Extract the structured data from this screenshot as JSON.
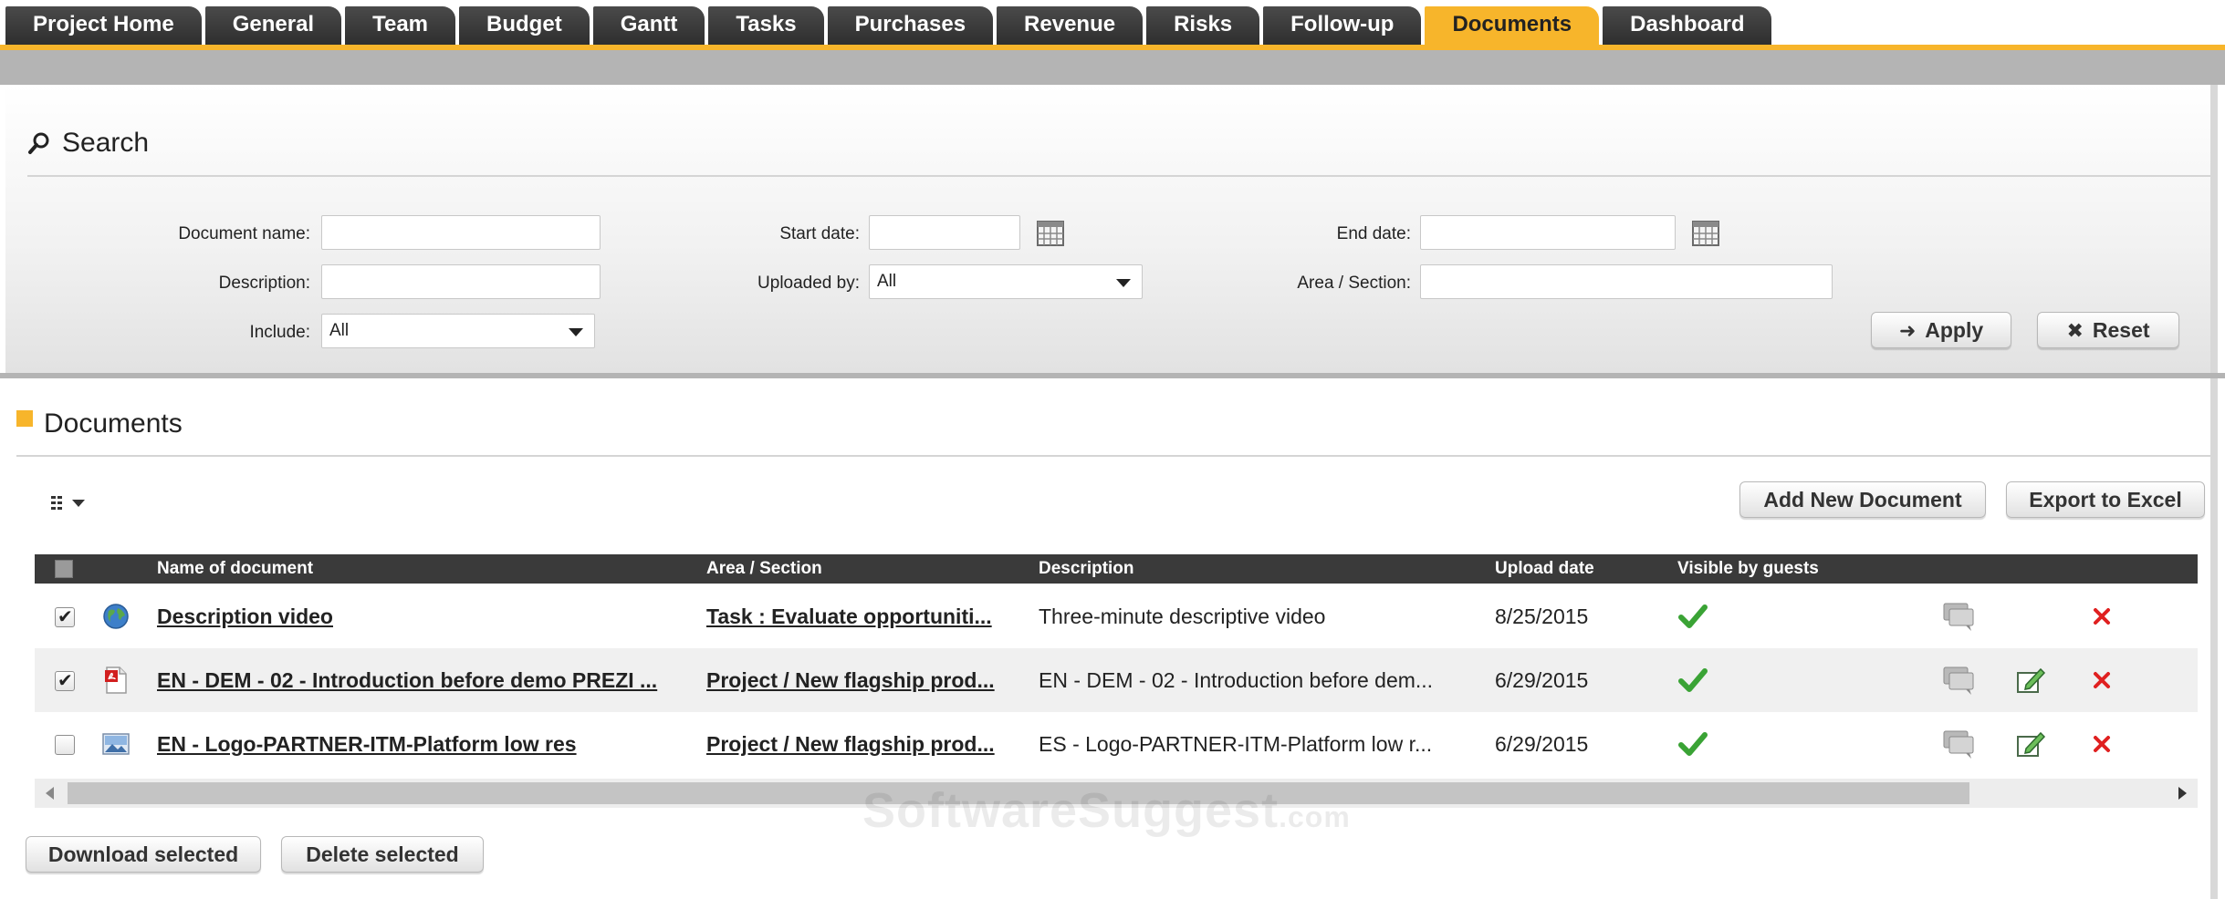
{
  "tabs": [
    {
      "label": "Project Home",
      "active": false
    },
    {
      "label": "General",
      "active": false
    },
    {
      "label": "Team",
      "active": false
    },
    {
      "label": "Budget",
      "active": false
    },
    {
      "label": "Gantt",
      "active": false
    },
    {
      "label": "Tasks",
      "active": false
    },
    {
      "label": "Purchases",
      "active": false
    },
    {
      "label": "Revenue",
      "active": false
    },
    {
      "label": "Risks",
      "active": false
    },
    {
      "label": "Follow-up",
      "active": false
    },
    {
      "label": "Documents",
      "active": true
    },
    {
      "label": "Dashboard",
      "active": false
    }
  ],
  "colors": {
    "accent": "#f7b52b",
    "tab_dark": "#3a3a3a",
    "check_green": "#3aa335",
    "delete_red": "#e02020"
  },
  "search": {
    "title": "Search",
    "icon": "search-icon",
    "fields": {
      "document_name": {
        "label": "Document name:",
        "value": ""
      },
      "description": {
        "label": "Description:",
        "value": ""
      },
      "include": {
        "label": "Include:",
        "value": "All"
      },
      "start_date": {
        "label": "Start date:",
        "value": ""
      },
      "uploaded_by": {
        "label": "Uploaded by:",
        "value": "All"
      },
      "end_date": {
        "label": "End date:",
        "value": ""
      },
      "area_section": {
        "label": "Area / Section:",
        "value": ""
      }
    },
    "apply_label": "Apply",
    "reset_label": "Reset"
  },
  "documents": {
    "title": "Documents",
    "add_button": "Add New Document",
    "export_button": "Export to Excel",
    "columns": {
      "name": "Name of document",
      "area": "Area / Section",
      "description": "Description",
      "upload_date": "Upload date",
      "visible": "Visible by guests"
    },
    "rows": [
      {
        "checked": true,
        "icon": "globe-icon",
        "name": "Description video",
        "area": "Task : Evaluate opportuniti...",
        "description": "Three-minute descriptive video",
        "upload_date": "8/25/2015",
        "visible": true,
        "editable": false
      },
      {
        "checked": true,
        "icon": "pdf-icon",
        "name": "EN - DEM - 02 - Introduction before demo PREZI ...",
        "area": "Project / New flagship prod...",
        "description": "EN - DEM - 02 - Introduction before dem...",
        "upload_date": "6/29/2015",
        "visible": true,
        "editable": true
      },
      {
        "checked": false,
        "icon": "image-icon",
        "name": "EN - Logo-PARTNER-ITM-Platform low res",
        "area": "Project / New flagship prod...",
        "description": "ES - Logo-PARTNER-ITM-Platform low r...",
        "upload_date": "6/29/2015",
        "visible": true,
        "editable": true
      }
    ],
    "download_selected": "Download selected",
    "delete_selected": "Delete selected"
  },
  "watermark": {
    "main": "SoftwareSuggest",
    "suffix": ".com"
  }
}
